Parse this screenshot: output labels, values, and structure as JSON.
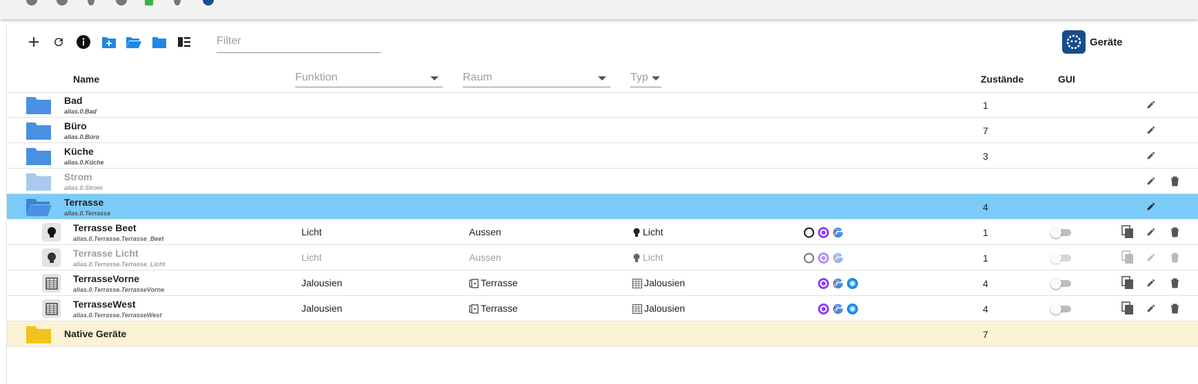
{
  "toolbar": {
    "filter_placeholder": "Filter",
    "brand_label": "Geräte"
  },
  "header": {
    "name": "Name",
    "funktion": "Funktion",
    "raum": "Raum",
    "typ": "Typ",
    "zustaende": "Zustände",
    "gui": "GUI"
  },
  "folders": [
    {
      "title": "Bad",
      "id": "alias.0.Bad",
      "count": "1"
    },
    {
      "title": "Büro",
      "id": "alias.0.Büro",
      "count": "7"
    },
    {
      "title": "Küche",
      "id": "alias.0.Küche",
      "count": "3"
    },
    {
      "title": "Strom",
      "id": "alias.0.Strom",
      "count": ""
    },
    {
      "title": "Terrasse",
      "id": "alias.0.Terrasse",
      "count": "4"
    }
  ],
  "devices": [
    {
      "title": "Terrasse Beet",
      "id": "alias.0.Terrasse.Terrasse_Beet",
      "funktion": "Licht",
      "raum": "Aussen",
      "typ": "Licht",
      "count": "1",
      "icon": "lightbulb-icon",
      "services": [
        "voice-assistant-ring",
        "alexa",
        "google"
      ]
    },
    {
      "title": "Terrasse Licht",
      "id": "alias.0.Terrasse.Terrasse_Licht",
      "funktion": "Licht",
      "raum": "Aussen",
      "typ": "Licht",
      "count": "1",
      "icon": "lightbulb-icon",
      "services": [
        "voice-assistant-ring",
        "alexa",
        "google"
      ]
    },
    {
      "title": "TerrasseVorne",
      "id": "alias.0.Terrasse.TerrasseVorne",
      "funktion": "Jalousien",
      "raum": "Terrasse",
      "typ": "Jalousien",
      "count": "4",
      "icon": "blinds-icon",
      "services": [
        "alexa",
        "google",
        "material-service"
      ]
    },
    {
      "title": "TerrasseWest",
      "id": "alias.0.Terrasse.TerrasseWest",
      "funktion": "Jalousien",
      "raum": "Terrasse",
      "typ": "Jalousien",
      "count": "4",
      "icon": "blinds-icon",
      "services": [
        "alexa",
        "google",
        "material-service"
      ]
    }
  ],
  "native": {
    "title": "Native Geräte",
    "count": "7"
  },
  "colors": {
    "folder_blue": "#4a90e2",
    "folder_dim": "#a9c9ee",
    "selected_row": "#7bcbf8",
    "native_row": "#fcf3d4",
    "native_folder": "#f2c31a",
    "alexa": "#8a3ffc",
    "material": "#1e88e5"
  }
}
